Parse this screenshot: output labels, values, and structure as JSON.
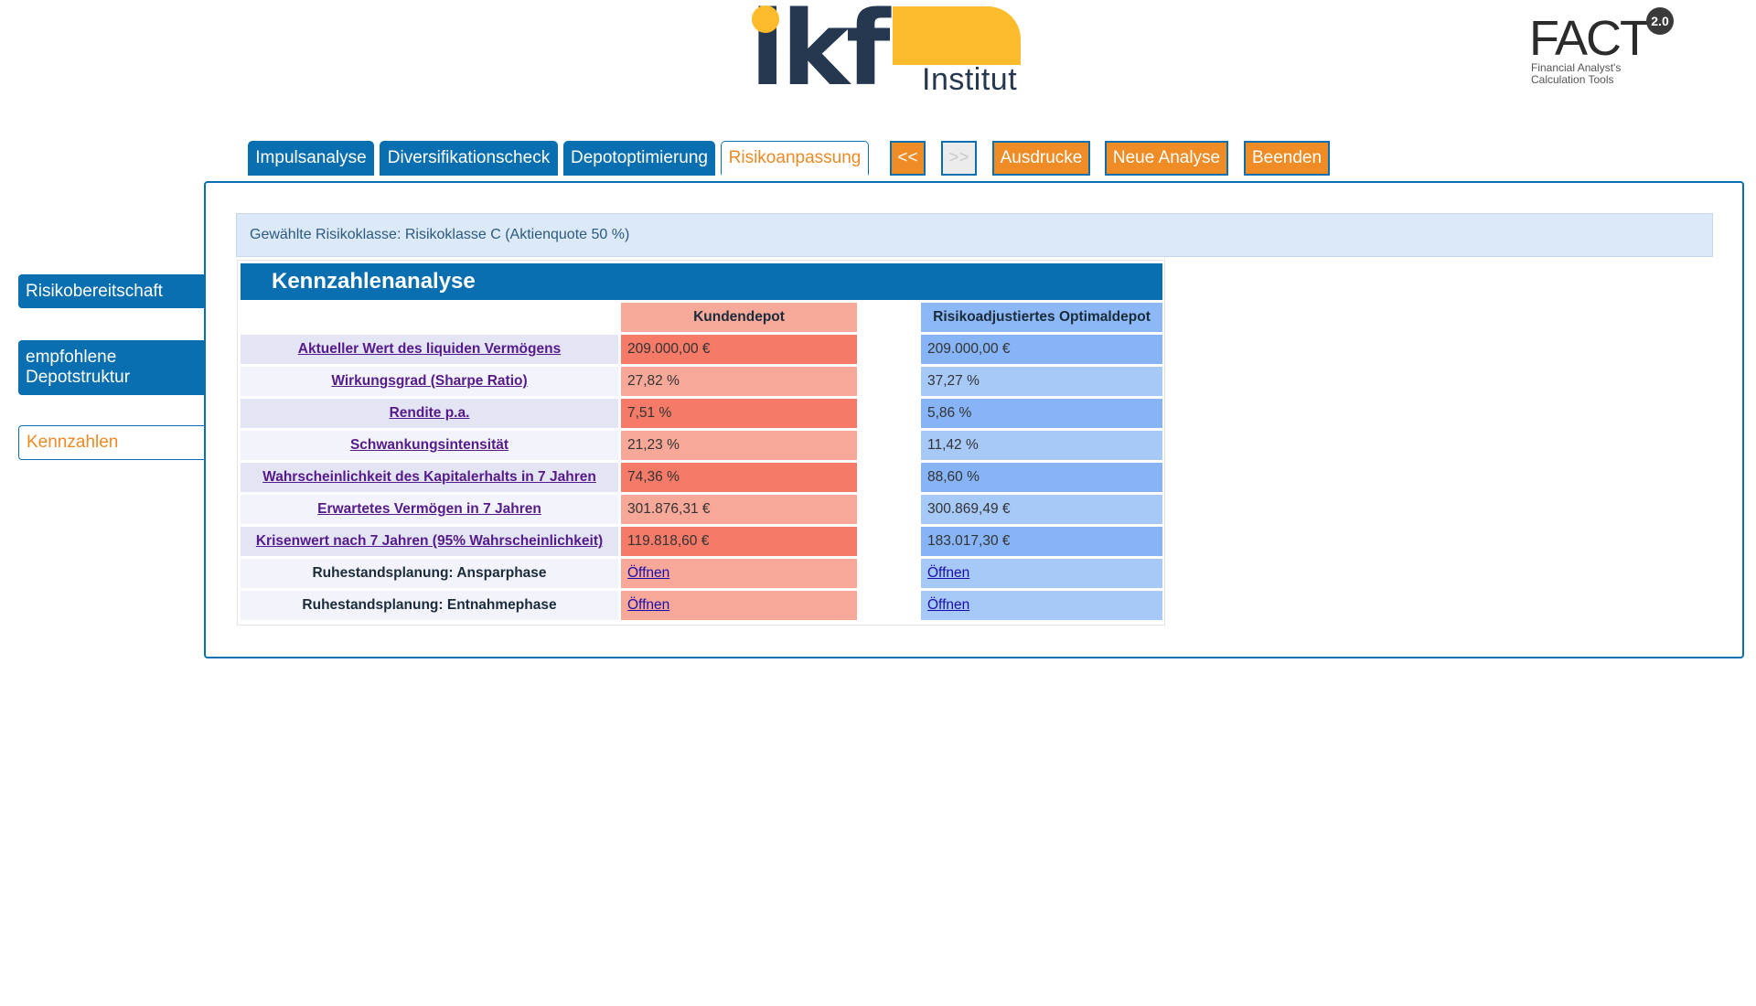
{
  "logo": {
    "ikf_letters": "ikf",
    "ikf_subtitle": "Institut",
    "fact_title": "FACT",
    "fact_version": "2.0",
    "fact_sub1": "Financial Analyst's",
    "fact_sub2": "Calculation Tools"
  },
  "topnav": {
    "tabs": [
      "Impulsanalyse",
      "Diversifikationscheck",
      "Depotoptimierung",
      "Risikoanpassung"
    ],
    "prev": "<<",
    "next": ">>",
    "print": "Ausdrucke",
    "new_analysis": "Neue Analyse",
    "quit": "Beenden"
  },
  "sidebar": {
    "items": [
      "Risikobereitschaft",
      "empfohlene Depotstruktur",
      "Kennzahlen"
    ]
  },
  "risk_class": "Gewählte Risikoklasse: Risikoklasse C (Aktienquote 50 %)",
  "kennzahlen": {
    "title": "Kennzahlenanalyse",
    "col_kunde": "Kundendepot",
    "col_optimal": "Risikoadjustiertes Optimaldepot",
    "rows": [
      {
        "label": "Aktueller Wert des liquiden Vermögens",
        "kunde": "209.000,00 €",
        "optimal": "209.000,00 €"
      },
      {
        "label": "Wirkungsgrad (Sharpe Ratio)",
        "kunde": "27,82 %",
        "optimal": "37,27 %"
      },
      {
        "label": "Rendite p.a.",
        "kunde": "7,51 %",
        "optimal": "5,86 %"
      },
      {
        "label": "Schwankungsintensität",
        "kunde": "21,23 %",
        "optimal": "11,42 %"
      },
      {
        "label": "Wahrscheinlichkeit des Kapitalerhalts in 7 Jahren",
        "kunde": "74,36 %",
        "optimal": "88,60 %"
      },
      {
        "label": "Erwartetes Vermögen in 7 Jahren",
        "kunde": "301.876,31 €",
        "optimal": "300.869,49 €"
      },
      {
        "label": "Krisenwert nach 7 Jahren (95% Wahrscheinlichkeit)",
        "kunde": "119.818,60 €",
        "optimal": "183.017,30 €"
      },
      {
        "label": "Ruhestandsplanung: Ansparphase",
        "kunde": "Öffnen",
        "optimal": "Öffnen"
      },
      {
        "label": "Ruhestandsplanung: Entnahmephase",
        "kunde": "Öffnen",
        "optimal": "Öffnen"
      }
    ]
  },
  "colors": {
    "accent_blue": "#0a6fb0",
    "accent_orange": "#ef8c26",
    "brand_yellow": "#fbbb2a",
    "brand_navy": "#25384f"
  }
}
